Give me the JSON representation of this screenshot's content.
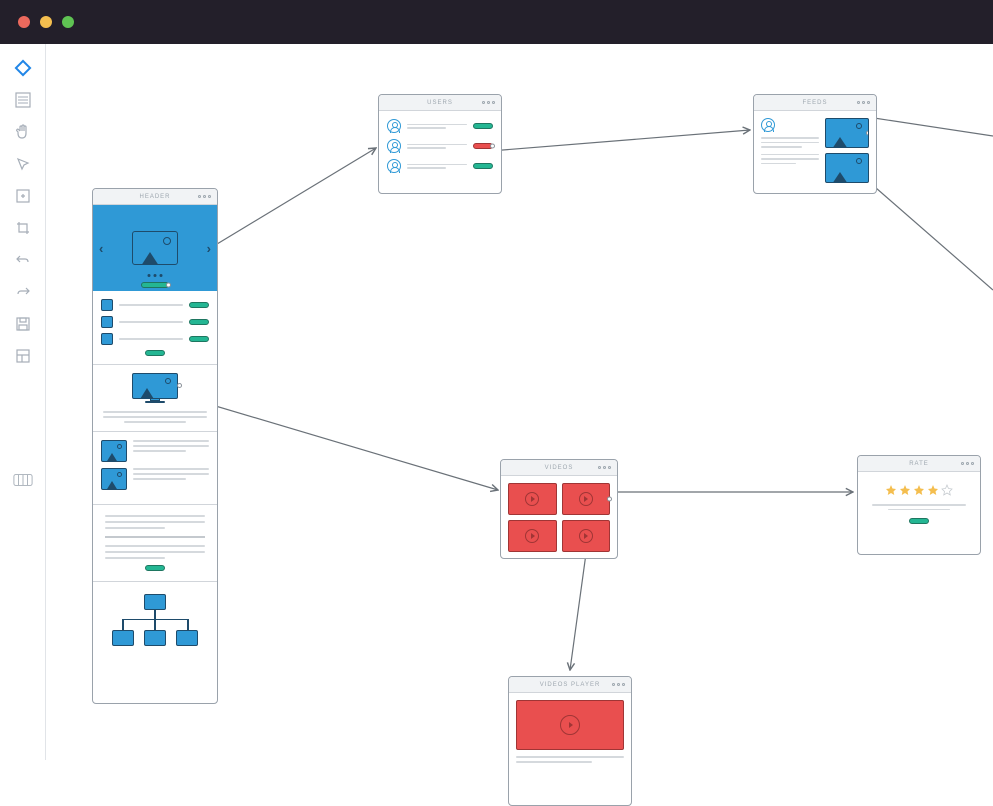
{
  "frames": {
    "header": "HEADER",
    "users": "USERS",
    "feeds": "FEEDS",
    "videos": "VIDEOS",
    "rate": "RATE",
    "player": "VIDEOS PLAYER"
  },
  "sidebar_icons": [
    "logo",
    "list",
    "hand",
    "pointer",
    "expand",
    "crop",
    "undo",
    "redo",
    "save",
    "layout",
    "grid"
  ],
  "star_rating": {
    "filled": 4,
    "total": 5
  }
}
